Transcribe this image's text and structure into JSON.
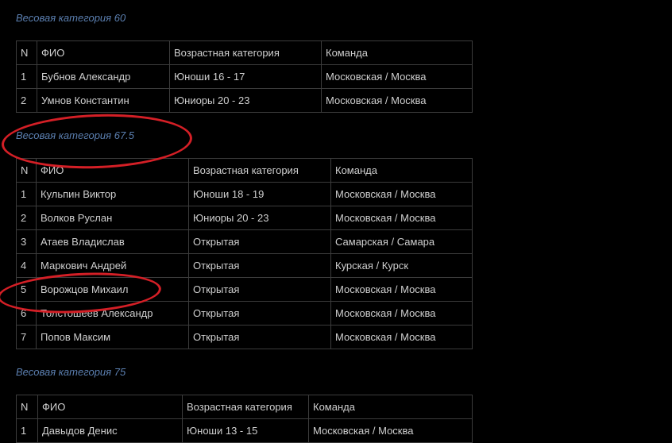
{
  "categories": [
    {
      "title": "Весовая категория 60",
      "headers": [
        "N",
        "ФИО",
        "Возрастная категория",
        "Команда"
      ],
      "rows": [
        [
          "1",
          "Бубнов Александр",
          "Юноши 16 - 17",
          "Московская / Москва"
        ],
        [
          "2",
          "Умнов Константин",
          "Юниоры 20 - 23",
          "Московская / Москва"
        ]
      ]
    },
    {
      "title": "Весовая категория 67.5",
      "headers": [
        "N",
        "ФИО",
        "Возрастная категория",
        "Команда"
      ],
      "rows": [
        [
          "1",
          "Кульпин Виктор",
          "Юноши 18 - 19",
          "Московская / Москва"
        ],
        [
          "2",
          "Волков Руслан",
          "Юниоры 20 - 23",
          "Московская / Москва"
        ],
        [
          "3",
          "Атаев Владислав",
          "Открытая",
          "Самарская / Самара"
        ],
        [
          "4",
          "Маркович Андрей",
          "Открытая",
          "Курская / Курск"
        ],
        [
          "5",
          "Ворожцов Михаил",
          "Открытая",
          "Московская / Москва"
        ],
        [
          "6",
          "Толстошеев Александр",
          "Открытая",
          "Московская / Москва"
        ],
        [
          "7",
          "Попов Максим",
          "Открытая",
          "Московская / Москва"
        ]
      ]
    },
    {
      "title": "Весовая категория 75",
      "headers": [
        "N",
        "ФИО",
        "Возрастная категория",
        "Команда"
      ],
      "rows": [
        [
          "1",
          "Давыдов Денис",
          "Юноши 13 - 15",
          "Московская / Москва"
        ]
      ]
    }
  ],
  "colors": {
    "background": "#000000",
    "category_title": "#5b7fb0",
    "table_border": "#3c3c3c",
    "highlight_circle": "#d41f26"
  }
}
